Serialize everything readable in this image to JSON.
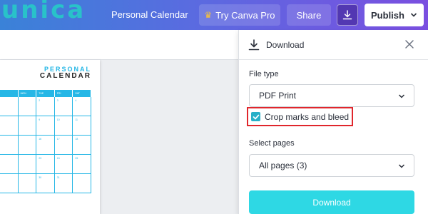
{
  "app": {
    "logo_text": "unica"
  },
  "header": {
    "document_title": "Personal Calendar",
    "try_pro_label": "Try Canva Pro",
    "share_label": "Share",
    "publish_label": "Publish"
  },
  "calendar": {
    "title_line1": "PERSONAL",
    "title_line2": "CALENDAR",
    "day_headers": [
      "MON",
      "TUE",
      "FRI",
      "SAT"
    ],
    "rows": [
      [
        "",
        "2",
        "3",
        "4"
      ],
      [
        "",
        "9",
        "10",
        "11"
      ],
      [
        "",
        "16",
        "17",
        "18"
      ],
      [
        "",
        "23",
        "24",
        "25"
      ],
      [
        "",
        "30",
        "31",
        ""
      ]
    ]
  },
  "download_panel": {
    "title": "Download",
    "file_type_label": "File type",
    "file_type_value": "PDF Print",
    "crop_marks_label": "Crop marks and bleed",
    "crop_marks_checked": true,
    "select_pages_label": "Select pages",
    "select_pages_value": "All pages (3)",
    "download_button_label": "Download"
  },
  "colors": {
    "accent_cyan": "#2ed8e4",
    "checkbox": "#27b0c8",
    "highlight_red": "#e0262c",
    "calendar_blue": "#26b7e6"
  }
}
